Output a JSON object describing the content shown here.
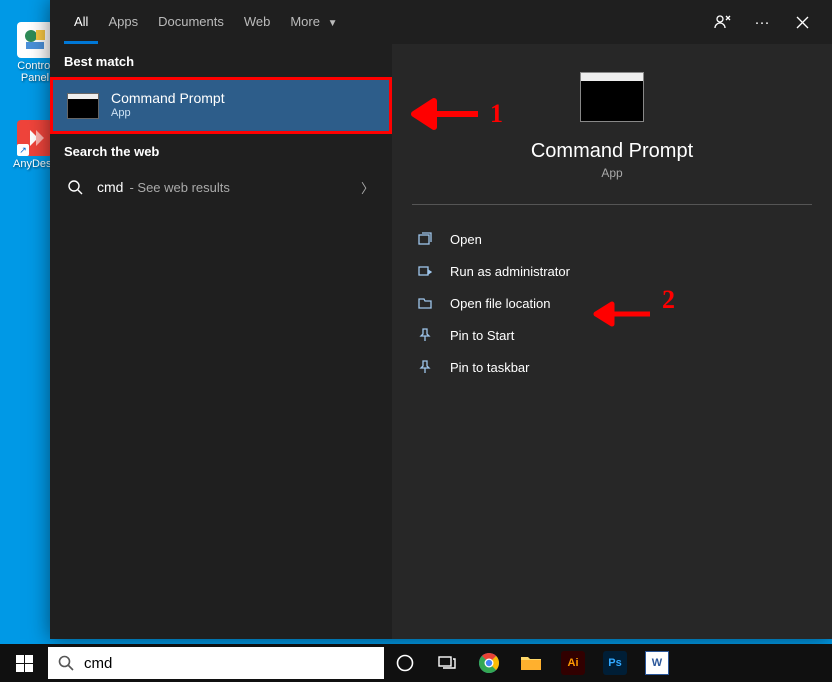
{
  "desktop": {
    "icons": [
      {
        "name": "control-panel",
        "label": "Control Panel",
        "bg": "#ffffff"
      },
      {
        "name": "anydesk",
        "label": "AnyDesk",
        "bg": "#ef443b"
      }
    ]
  },
  "tabs": {
    "items": [
      "All",
      "Apps",
      "Documents",
      "Web",
      "More"
    ],
    "active": 0
  },
  "left": {
    "best_match_header": "Best match",
    "best_match": {
      "title": "Command Prompt",
      "subtitle": "App"
    },
    "web_header": "Search the web",
    "web": {
      "query": "cmd",
      "hint": "- See web results"
    }
  },
  "preview": {
    "title": "Command Prompt",
    "subtitle": "App",
    "actions": [
      {
        "icon": "open",
        "label": "Open"
      },
      {
        "icon": "admin",
        "label": "Run as administrator"
      },
      {
        "icon": "folder",
        "label": "Open file location"
      },
      {
        "icon": "pin",
        "label": "Pin to Start"
      },
      {
        "icon": "pin",
        "label": "Pin to taskbar"
      }
    ]
  },
  "annotations": {
    "a1": "1",
    "a2": "2"
  },
  "taskbar": {
    "search_value": "cmd",
    "apps": [
      "chrome",
      "explorer",
      "illustrator",
      "photoshop",
      "word"
    ]
  }
}
